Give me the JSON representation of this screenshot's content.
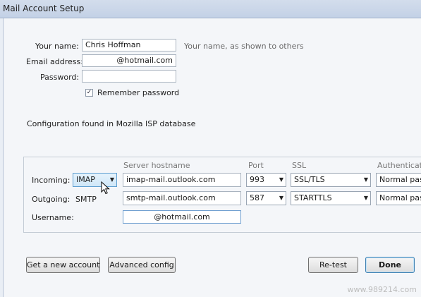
{
  "window": {
    "title": "Mail Account Setup"
  },
  "account": {
    "name_label": "Your name:",
    "name_value": "Chris Hoffman",
    "name_hint": "Your name, as shown to others",
    "email_label": "Email address:",
    "email_value": "@hotmail.com",
    "password_label": "Password:",
    "password_value": "",
    "remember_label": "Remember password",
    "remember_checked": true
  },
  "status": {
    "message": "Configuration found in Mozilla ISP database"
  },
  "server": {
    "headers": {
      "hostname": "Server hostname",
      "port": "Port",
      "ssl": "SSL",
      "auth": "Authenticatio"
    },
    "incoming": {
      "label": "Incoming:",
      "protocol": "IMAP",
      "hostname": "imap-mail.outlook.com",
      "port": "993",
      "ssl": "SSL/TLS",
      "auth": "Normal pass"
    },
    "outgoing": {
      "label": "Outgoing:",
      "protocol": "SMTP",
      "hostname": "smtp-mail.outlook.com",
      "port": "587",
      "ssl": "STARTTLS",
      "auth": "Normal pass"
    },
    "username": {
      "label": "Username:",
      "value": "@hotmail.com"
    }
  },
  "buttons": {
    "new_account": "Get a new account",
    "advanced": "Advanced config",
    "retest": "Re-test",
    "done": "Done"
  },
  "icons": {
    "dropdown": "chevron-down-icon",
    "check": "checkmark-icon",
    "cursor": "mouse-pointer-icon"
  },
  "watermark": "www.989214.com"
}
